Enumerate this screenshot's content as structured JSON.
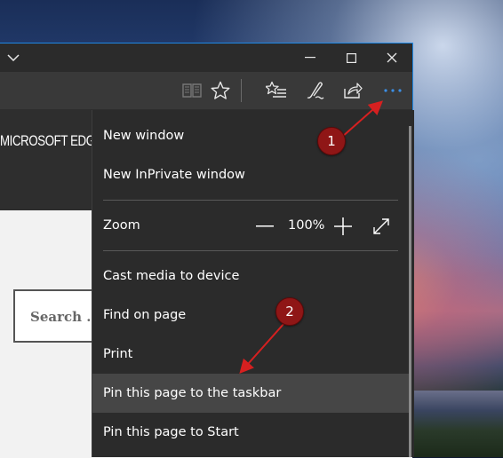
{
  "browser": {
    "toolbar_icons": [
      "reading-view-icon",
      "favorite-star-icon",
      "favorites-hub-icon",
      "web-note-icon",
      "share-icon",
      "more-actions-icon"
    ],
    "site_title": "MICROSOFT EDGE",
    "search_placeholder": "Search …"
  },
  "menu": {
    "items": [
      {
        "label": "New window"
      },
      {
        "label": "New InPrivate window"
      },
      {
        "label": "Cast media to device"
      },
      {
        "label": "Find on page"
      },
      {
        "label": "Print"
      },
      {
        "label": "Pin this page to the taskbar"
      },
      {
        "label": "Pin this page to Start"
      }
    ],
    "zoom": {
      "label": "Zoom",
      "value": "100%"
    }
  },
  "annotations": {
    "badge1": "1",
    "badge2": "2",
    "color": "#8f1616",
    "arrow_color": "#d62020"
  },
  "colors": {
    "accent": "#1e88e5",
    "menu_bg": "#2b2b2b",
    "highlight": "#464646"
  }
}
